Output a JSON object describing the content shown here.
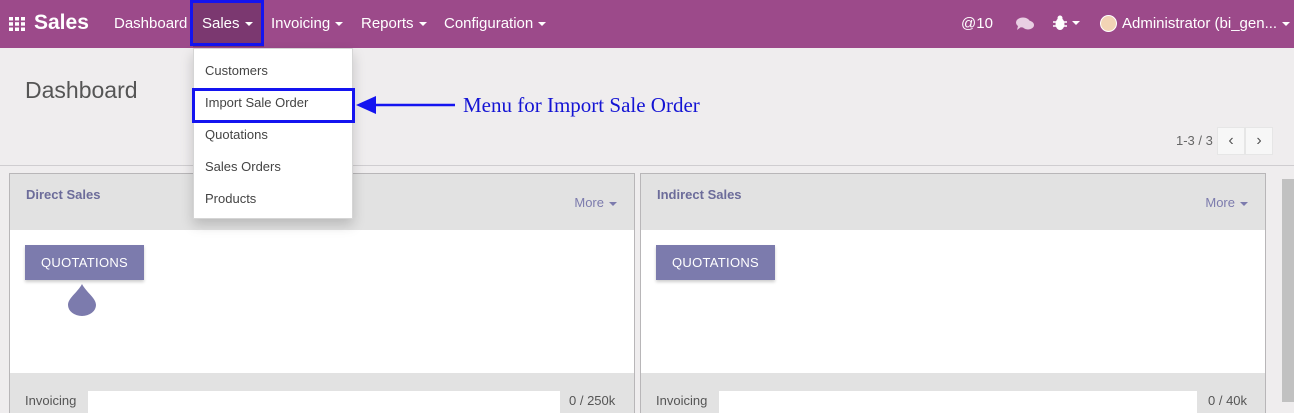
{
  "navbar": {
    "brand": "Sales",
    "menus": [
      {
        "label": "Dashboard"
      },
      {
        "label": "Sales"
      },
      {
        "label": "Invoicing"
      },
      {
        "label": "Reports"
      },
      {
        "label": "Configuration"
      }
    ],
    "mentions_count": "10",
    "user": "Administrator (bi_gen..."
  },
  "sales_menu": {
    "items": [
      {
        "label": "Customers"
      },
      {
        "label": "Import Sale Order"
      },
      {
        "label": "Quotations"
      },
      {
        "label": "Sales Orders"
      },
      {
        "label": "Products"
      }
    ]
  },
  "annotation": {
    "text": "Menu for Import Sale Order"
  },
  "control_panel": {
    "title": "Dashboard",
    "pager": "1-3 / 3"
  },
  "cards": [
    {
      "title": "Direct Sales",
      "more": "More",
      "button": "QUOTATIONS",
      "footer_label": "Invoicing",
      "footer_value": "0 / 250k"
    },
    {
      "title": "Indirect Sales",
      "more": "More",
      "button": "QUOTATIONS",
      "footer_label": "Invoicing",
      "footer_value": "0 / 40k"
    }
  ],
  "colors": {
    "navbar": "#9c4a8a",
    "accent": "#7c7bad",
    "highlight": "#1414f0"
  }
}
